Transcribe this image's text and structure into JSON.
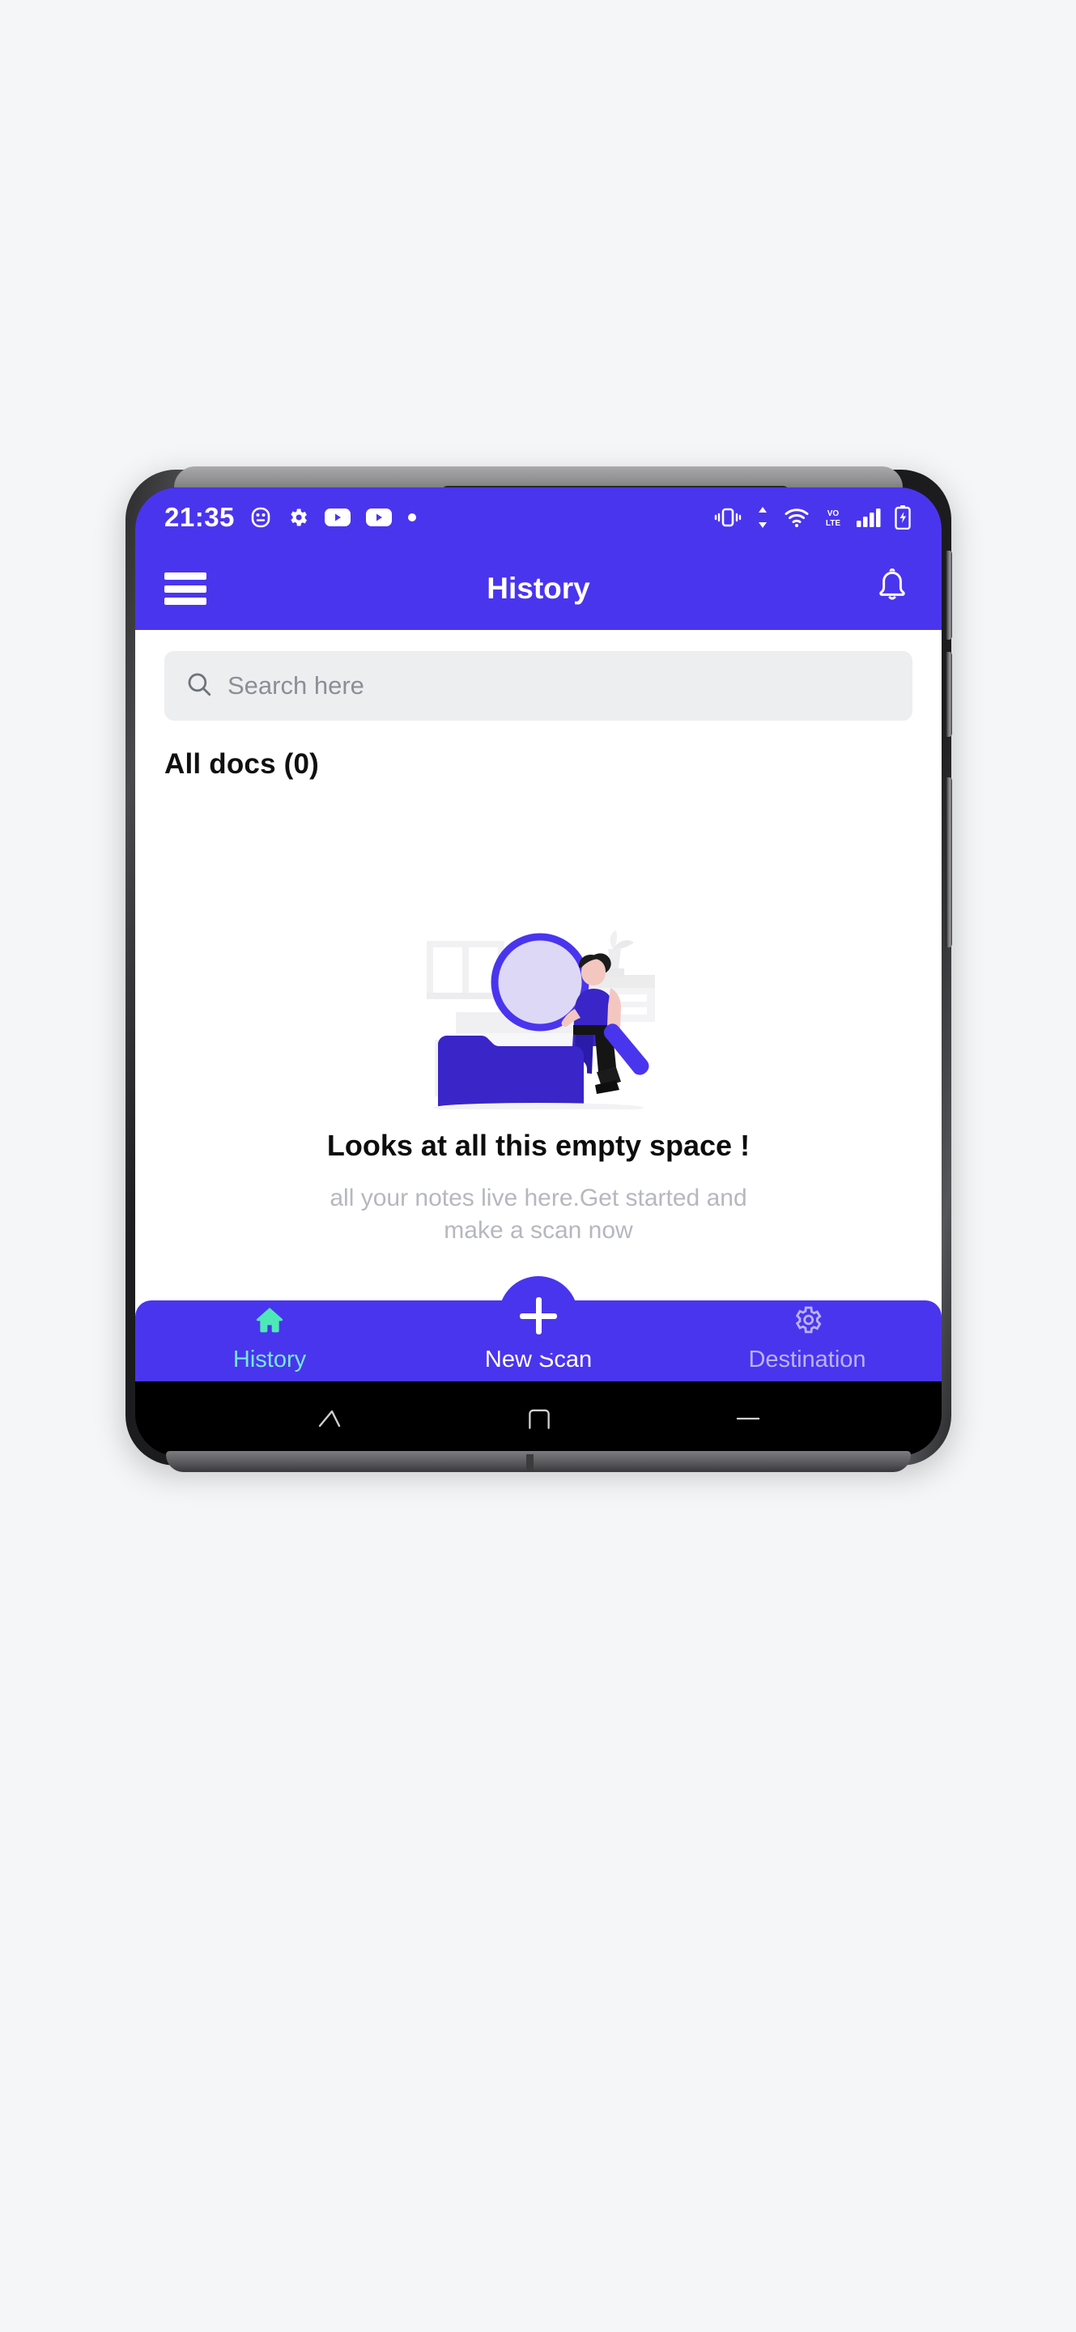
{
  "colors": {
    "brand_purple": "#4a35ee",
    "page_background": "#f5f6f8",
    "screen_background": "#ffffff",
    "search_field_background": "#eceef0",
    "active_nav": "#76e9da",
    "inactive_nav": "#b9b4f7",
    "heading_text": "#101010",
    "muted_text": "#b5b8bd",
    "placeholder_text": "#8b8f95",
    "illustration_folder": "#3a25c8",
    "illustration_ring": "#4a35ee",
    "illustration_lens": "#ddd8f5",
    "illustration_furniture": "#f0f0f2",
    "illustration_skin": "#f3c7c0",
    "illustration_hair": "#1b1b1b"
  },
  "status_bar": {
    "time": "21:35",
    "left_icons": [
      "android-head-icon",
      "gear-icon",
      "youtube-icon",
      "youtube-icon",
      "dot-icon"
    ],
    "right_icons": [
      "vibrate-icon",
      "data-transfer-icon",
      "wifi-icon",
      "volte-icon",
      "signal-bars-icon",
      "battery-charging-icon"
    ],
    "volte_label_top": "VO",
    "volte_label_bottom": "LTE"
  },
  "app_bar": {
    "menu_icon": "hamburger-menu-icon",
    "title": "History",
    "notification_icon": "bell-icon"
  },
  "search": {
    "icon": "search-icon",
    "placeholder": "Search here",
    "value": ""
  },
  "documents": {
    "heading": "All docs (0)",
    "count": 0
  },
  "empty_state": {
    "illustration_name": "empty-folder-illustration",
    "title": "Looks at all this empty space !",
    "subtitle": "all your notes live here.Get started and make a scan now"
  },
  "bottom_nav": {
    "items": [
      {
        "label": "History",
        "icon": "home-icon",
        "active": true
      },
      {
        "label": "New Scan",
        "icon": "plus-icon",
        "active": false
      },
      {
        "label": "Destination",
        "icon": "gear-icon",
        "active": false
      }
    ]
  },
  "android_nav": {
    "back_label": "back-icon",
    "home_label": "home-square-icon",
    "recents_label": "recents-dash-icon"
  }
}
